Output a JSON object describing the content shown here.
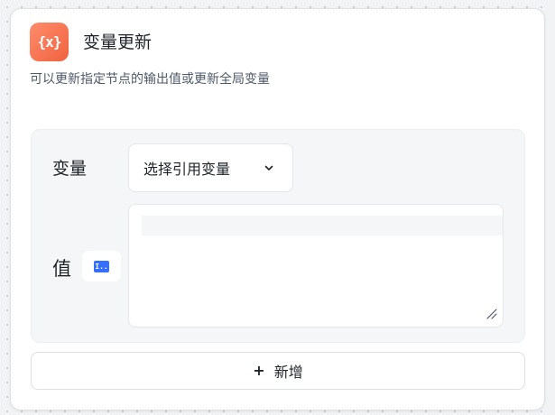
{
  "node": {
    "icon": "variable-braces-icon",
    "icon_glyph": "{x}",
    "title": "变量更新",
    "description": "可以更新指定节点的输出值或更新全局变量"
  },
  "form": {
    "variable_label": "变量",
    "variable_select": {
      "selected_text": "选择引用变量"
    },
    "value_label": "值",
    "value_type_icon": "text-type-icon",
    "value_type_glyph": "I.."
  },
  "actions": {
    "add_label": "新增",
    "add_icon": "plus-icon",
    "add_icon_glyph": "+"
  },
  "colors": {
    "node_icon_accent": "#f0623f",
    "value_type_accent": "#3370ff",
    "panel_background": "#f5f6f8"
  }
}
